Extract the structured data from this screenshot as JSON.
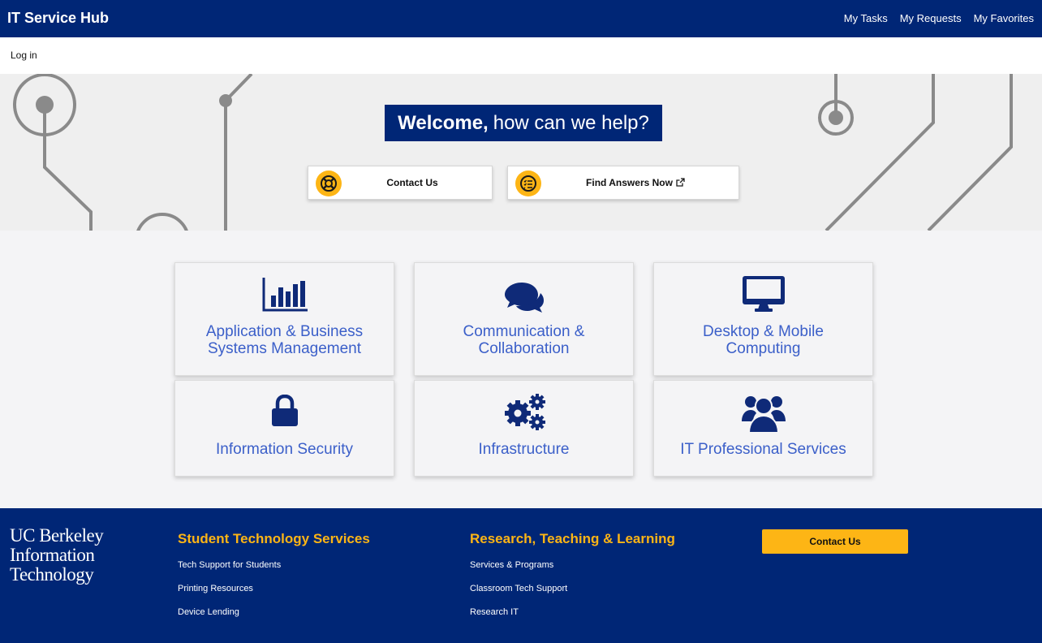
{
  "header": {
    "brand": "IT Service Hub",
    "nav": [
      "My Tasks",
      "My Requests",
      "My Favorites"
    ]
  },
  "login": {
    "label": "Log in"
  },
  "hero": {
    "welcome_bold": "Welcome,",
    "welcome_rest": "how can we help?",
    "contact_label": "Contact Us",
    "find_label": "Find Answers Now",
    "contact_icon": "lifebuoy-icon",
    "find_icon": "checklist-icon"
  },
  "tiles": [
    {
      "title_line1": "Application & Business",
      "title_line2": "Systems Management",
      "icon": "bar-chart-icon"
    },
    {
      "title_line1": "Communication &",
      "title_line2": "Collaboration",
      "icon": "chat-bubbles-icon"
    },
    {
      "title_line1": "Desktop & Mobile",
      "title_line2": "Computing",
      "icon": "monitor-icon"
    },
    {
      "title_line1": "Information Security",
      "icon": "lock-icon"
    },
    {
      "title_line1": "Infrastructure",
      "icon": "gears-icon"
    },
    {
      "title_line1": "IT Professional Services",
      "icon": "users-icon"
    }
  ],
  "footer": {
    "logo": [
      "UC Berkeley",
      "Information",
      "Technology"
    ],
    "col1": {
      "heading": "Student Technology Services",
      "links": [
        "Tech Support for Students",
        "Printing Resources",
        "Device Lending"
      ]
    },
    "col2": {
      "heading": "Research, Teaching & Learning",
      "links": [
        "Services & Programs",
        "Classroom Tech Support",
        "Research IT"
      ]
    },
    "contact_label": "Contact Us"
  },
  "colors": {
    "navy": "#002676",
    "gold": "#fdb515",
    "tile_text": "#3b5fc9"
  }
}
